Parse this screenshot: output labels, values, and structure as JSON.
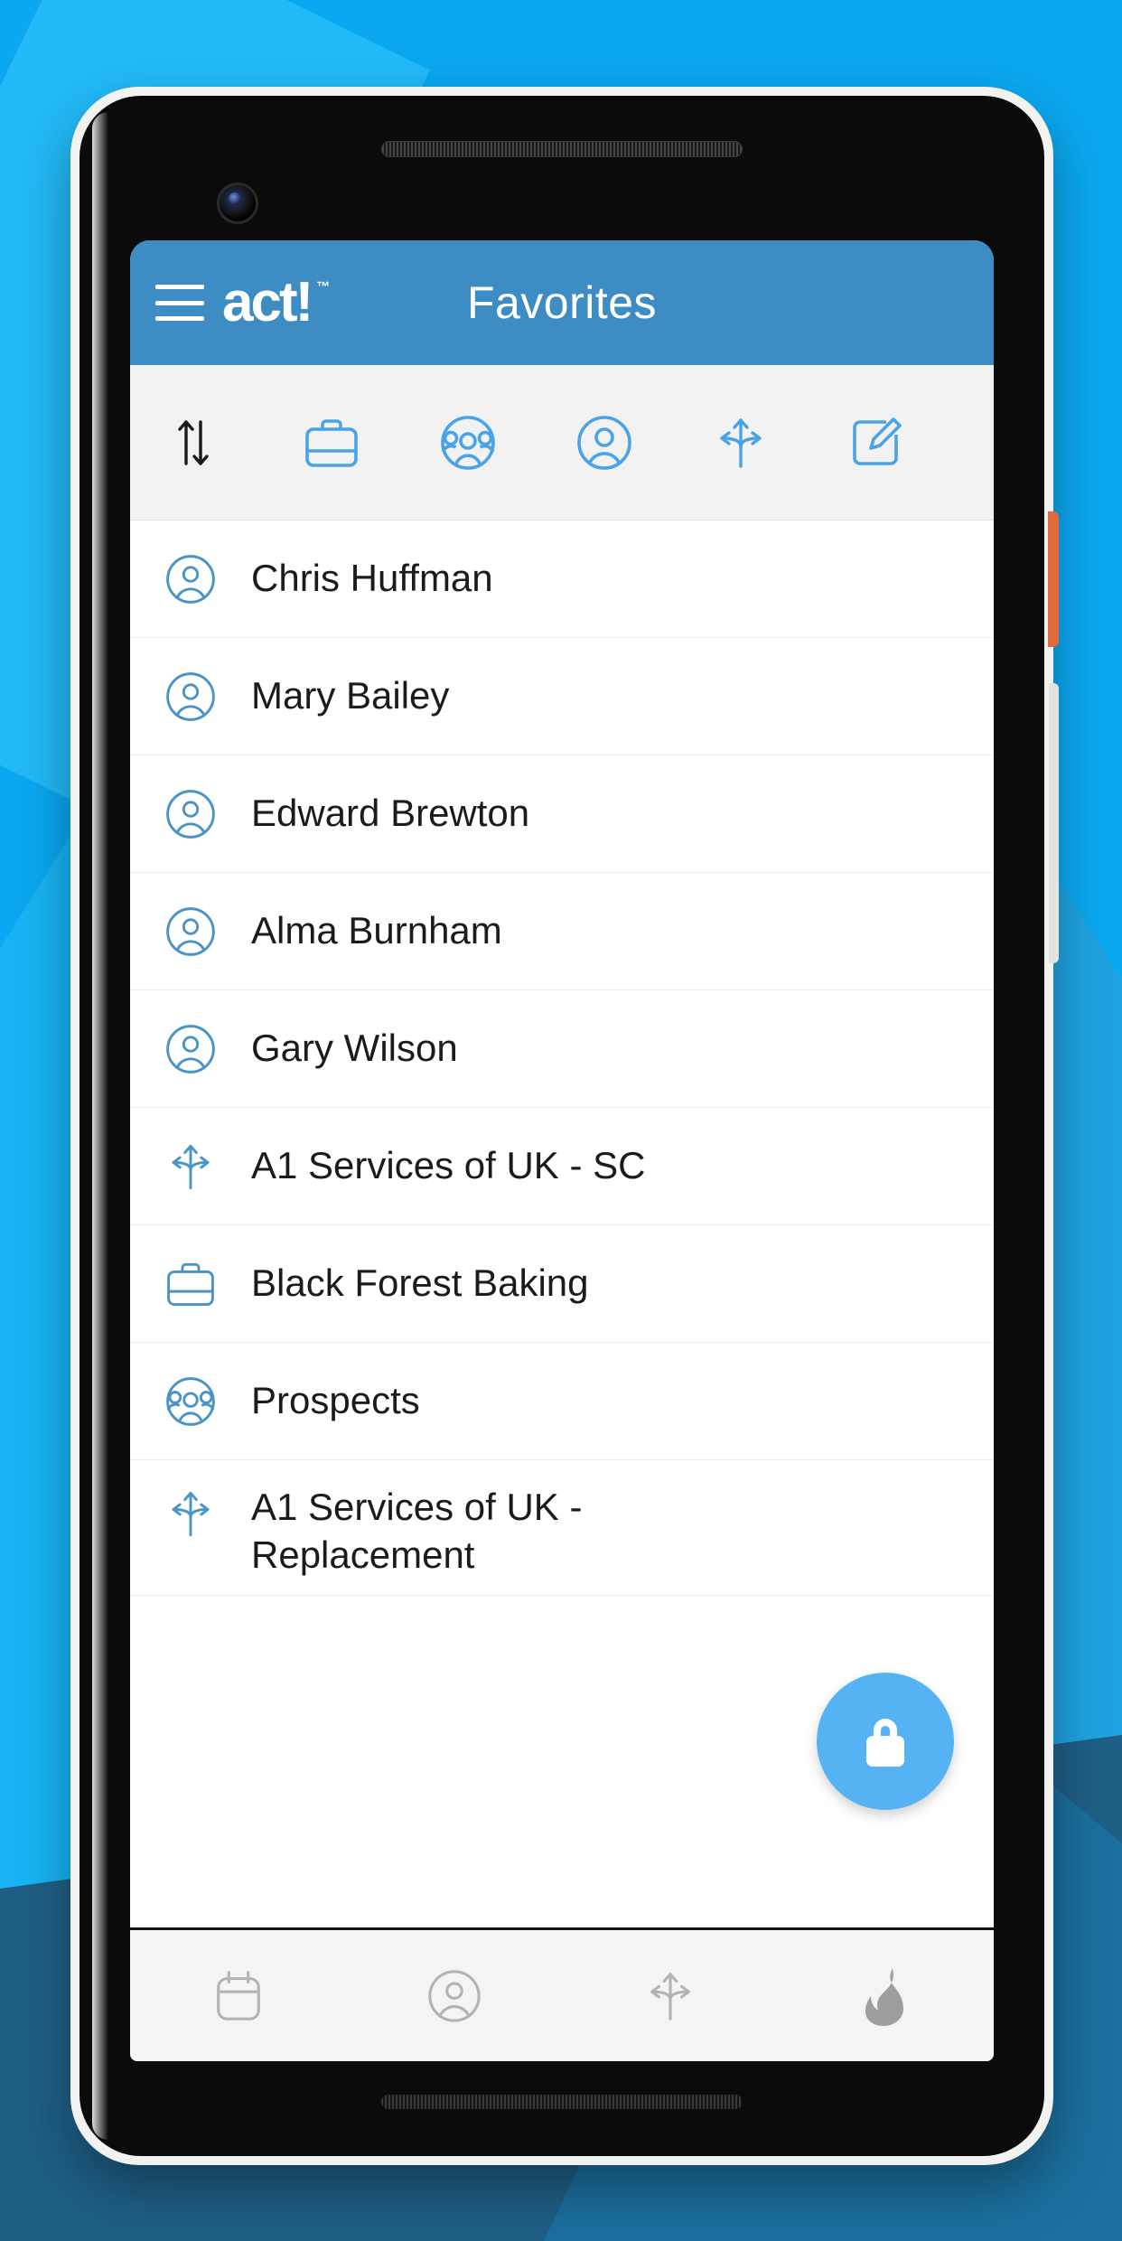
{
  "app": {
    "brand": "act!",
    "brand_tm": "™",
    "title": "Favorites",
    "menu_icon": "hamburger-menu-icon",
    "appbar_color": "#3d8dc4",
    "accent_color": "#55b3f3",
    "background_color": "#0aa8f0"
  },
  "toolbar": {
    "sort": {
      "name": "sort-up-down-icon",
      "label": "Sort"
    },
    "filters": [
      {
        "name": "briefcase-icon",
        "label": "Companies"
      },
      {
        "name": "group-icon",
        "label": "Groups"
      },
      {
        "name": "contact-icon",
        "label": "Contacts"
      },
      {
        "name": "opportunity-icon",
        "label": "Opportunities"
      },
      {
        "name": "edit-square-icon",
        "label": "Edit"
      }
    ]
  },
  "list": {
    "items": [
      {
        "label": "Chris Huffman",
        "icon": "contact-icon"
      },
      {
        "label": "Mary Bailey",
        "icon": "contact-icon"
      },
      {
        "label": "Edward Brewton",
        "icon": "contact-icon"
      },
      {
        "label": "Alma Burnham",
        "icon": "contact-icon"
      },
      {
        "label": "Gary Wilson",
        "icon": "contact-icon"
      },
      {
        "label": "A1 Services of UK - SC",
        "icon": "opportunity-icon"
      },
      {
        "label": "Black Forest Baking",
        "icon": "briefcase-icon"
      },
      {
        "label": "Prospects",
        "icon": "group-icon"
      },
      {
        "label": "A1 Services of UK - Replacement",
        "icon": "opportunity-icon"
      }
    ]
  },
  "fab": {
    "name": "lock-icon",
    "label": "Lock"
  },
  "bottom_nav": {
    "items": [
      {
        "name": "calendar-icon",
        "label": "Calendar"
      },
      {
        "name": "contact-icon",
        "label": "Contacts"
      },
      {
        "name": "opportunity-icon",
        "label": "Opportunities"
      },
      {
        "name": "flame-icon",
        "label": "Activity"
      }
    ]
  }
}
